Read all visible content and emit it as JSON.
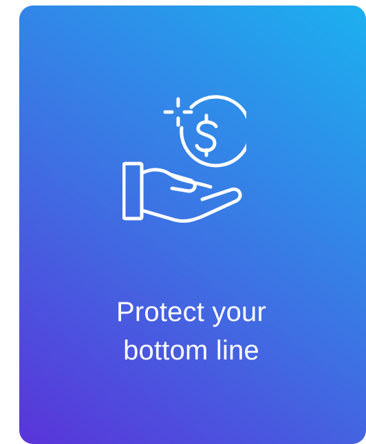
{
  "card": {
    "icon_name": "hand-holding-dollar-icon",
    "headline_line1": "Protect your",
    "headline_line2": "bottom line",
    "gradient_start": "#5a34d9",
    "gradient_end": "#1cb0ef",
    "text_color": "#ffffff"
  }
}
